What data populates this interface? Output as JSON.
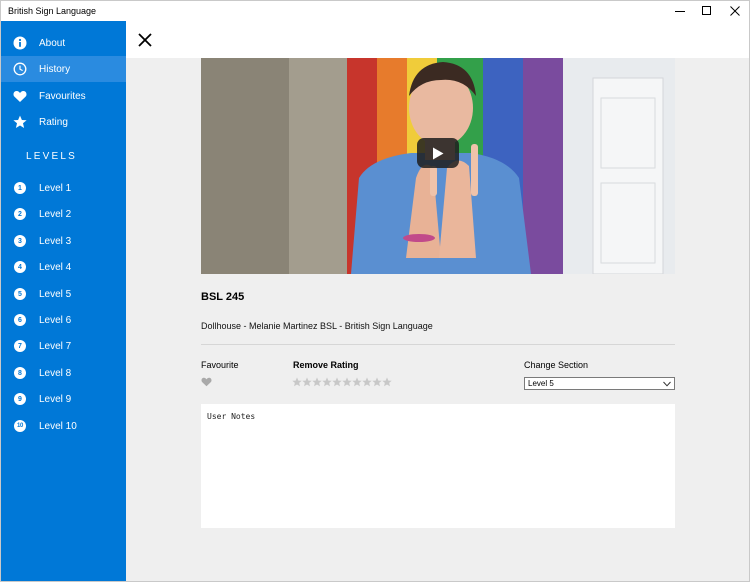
{
  "window": {
    "title": "British Sign Language"
  },
  "sidebar": {
    "items": [
      {
        "label": "About",
        "icon": "info-icon"
      },
      {
        "label": "History",
        "icon": "clock-icon",
        "selected": true
      },
      {
        "label": "Favourites",
        "icon": "heart-icon"
      },
      {
        "label": "Rating",
        "icon": "star-icon"
      }
    ],
    "levels_heading": "LEVELS",
    "levels": [
      {
        "num": "1",
        "label": "Level 1"
      },
      {
        "num": "2",
        "label": "Level 2"
      },
      {
        "num": "3",
        "label": "Level 3"
      },
      {
        "num": "4",
        "label": "Level 4"
      },
      {
        "num": "5",
        "label": "Level 5"
      },
      {
        "num": "6",
        "label": "Level 6"
      },
      {
        "num": "7",
        "label": "Level 7"
      },
      {
        "num": "8",
        "label": "Level 8"
      },
      {
        "num": "9",
        "label": "Level 9"
      },
      {
        "num": "10",
        "label": "Level 10"
      }
    ]
  },
  "video": {
    "title": "BSL 245",
    "description": "Dollhouse - Melanie Martinez BSL - British Sign Language"
  },
  "controls": {
    "favourite_label": "Favourite",
    "rating_label": "Remove Rating",
    "rating_value": 0,
    "rating_max": 10,
    "section_label": "Change Section",
    "section_value": "Level 5"
  },
  "notes": {
    "placeholder": "User Notes"
  },
  "colors": {
    "accent": "#0078d7",
    "selected": "#2a8be0",
    "background": "#efefef"
  }
}
